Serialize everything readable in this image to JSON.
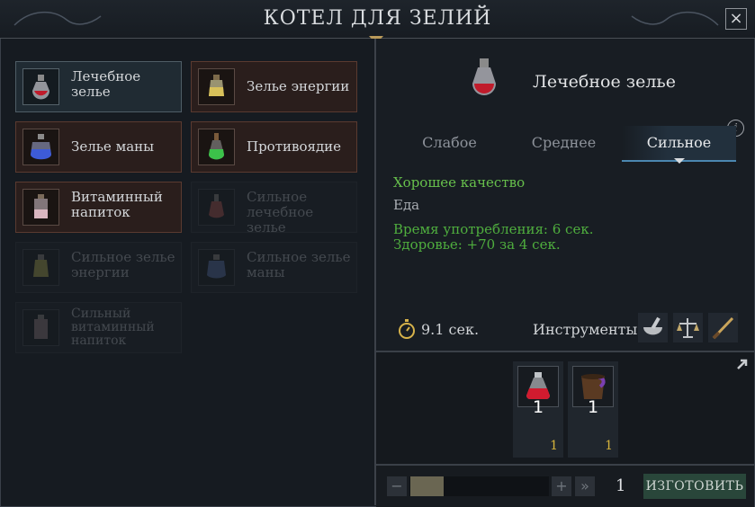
{
  "window": {
    "title": "КОТЕЛ ДЛЯ ЗЕЛИЙ",
    "close_icon": "×"
  },
  "recipes": [
    {
      "label": "Лечебное зелье",
      "line1": "Лечебное",
      "line2": "зелье",
      "state": "selected",
      "icon": "healing-potion-icon"
    },
    {
      "label": "Зелье энергии",
      "line1": "Зелье энергии",
      "line2": "",
      "state": "available",
      "icon": "energy-potion-icon"
    },
    {
      "label": "Зелье маны",
      "line1": "Зелье маны",
      "line2": "",
      "state": "available",
      "icon": "mana-potion-icon"
    },
    {
      "label": "Противоядие",
      "line1": "Противоядие",
      "line2": "",
      "state": "available",
      "icon": "antidote-icon"
    },
    {
      "label": "Витаминный напиток",
      "line1": "Витаминный",
      "line2": "напиток",
      "state": "available",
      "icon": "vitamin-drink-icon"
    },
    {
      "label": "Сильное лечебное зелье",
      "line1": "Сильное",
      "line2": "лечебное зелье",
      "state": "locked",
      "icon": "strong-healing-potion-icon"
    },
    {
      "label": "Сильное зелье энергии",
      "line1": "Сильное зелье",
      "line2": "энергии",
      "state": "locked",
      "icon": "strong-energy-potion-icon"
    },
    {
      "label": "Сильное зелье маны",
      "line1": "Сильное зелье",
      "line2": "маны",
      "state": "locked",
      "icon": "strong-mana-potion-icon"
    },
    {
      "label": "Сильный витаминный напиток",
      "line1": "Сильный",
      "line2": "витаминный",
      "line3": "напиток",
      "state": "locked",
      "icon": "strong-vitamin-drink-icon"
    }
  ],
  "detail": {
    "title": "Лечебное зелье",
    "tabs": [
      {
        "label": "Слабое",
        "active": false
      },
      {
        "label": "Среднее",
        "active": false
      },
      {
        "label": "Сильное",
        "active": true
      }
    ],
    "quality": "Хорошее качество",
    "category": "Еда",
    "stats": [
      "Время употребления: 6 сек.",
      "Здоровье: +70 за 4 сек."
    ],
    "craft_time": "9.1 сек.",
    "tools_label": "Инструменты:",
    "tools": [
      "mortar-pestle-icon",
      "scales-icon",
      "knife-icon"
    ],
    "info_icon": "i"
  },
  "ingredients": [
    {
      "icon": "red-flask-icon",
      "required": "1",
      "owned": "1"
    },
    {
      "icon": "wooden-bucket-icon",
      "required": "1",
      "owned": "1"
    }
  ],
  "craft": {
    "minus": "−",
    "plus": "+",
    "max": "»",
    "quantity": "1",
    "button_label": "ИЗГОТОВИТЬ"
  },
  "colors": {
    "quality_green": "#67c04c",
    "stat_green": "#4fae3e",
    "owned_gold": "#d5b33c",
    "tab_underline": "#4b87b0",
    "craft_button": "#29463a"
  }
}
